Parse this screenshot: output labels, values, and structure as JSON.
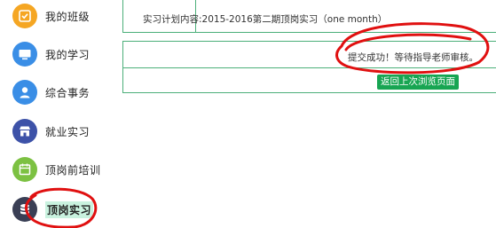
{
  "sidebar": {
    "items": [
      {
        "label": "我的班级",
        "icon": "class-icon",
        "color": "#f5a623"
      },
      {
        "label": "我的学习",
        "icon": "monitor-icon",
        "color": "#3a8ee6"
      },
      {
        "label": "综合事务",
        "icon": "user-icon",
        "color": "#3a8ee6"
      },
      {
        "label": "就业实习",
        "icon": "store-icon",
        "color": "#3d52a8"
      },
      {
        "label": "顶岗前培训",
        "icon": "calendar-icon",
        "color": "#7cc142"
      },
      {
        "label": "顶岗实习",
        "icon": "database-icon",
        "color": "#3a3f55",
        "active": true
      }
    ]
  },
  "main": {
    "plan_label": "实习计划内容:",
    "plan_value": "2015-2016第二期顶岗实习（one month）",
    "notice": "提交成功！等待指导老师审核。",
    "back_button": "返回上次浏览页面"
  },
  "colors": {
    "accent": "#17a552",
    "border": "#4caf7a",
    "annotation": "#e01010",
    "active_highlight": "#c9f2df"
  }
}
